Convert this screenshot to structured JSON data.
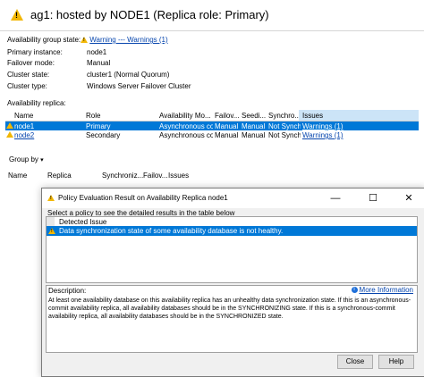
{
  "header": {
    "title": "ag1: hosted by NODE1 (Replica role: Primary)"
  },
  "properties": [
    {
      "label": "Availability group state:",
      "value": "Warning --- Warnings (1)",
      "is_link": true
    },
    {
      "label": "Primary instance:",
      "value": "node1"
    },
    {
      "label": "Failover mode:",
      "value": "Manual"
    },
    {
      "label": "Cluster state:",
      "value": "cluster1 (Normal Quorum)"
    },
    {
      "label": "Cluster type:",
      "value": "Windows Server Failover Cluster"
    }
  ],
  "replica_section": {
    "label": "Availability replica:",
    "columns": [
      "Name",
      "Role",
      "Availability Mo...",
      "Failov...",
      "Seedi...",
      "Synchro...",
      "Issues"
    ],
    "rows": [
      {
        "name": "node1",
        "role": "Primary",
        "availability_mode": "Asynchronous co...",
        "failover": "Manual",
        "seeding": "Manual",
        "sync": "Not Synchron...",
        "issues": "Warnings (1)"
      },
      {
        "name": "node2",
        "role": "Secondary",
        "availability_mode": "Asynchronous co...",
        "failover": "Manual",
        "seeding": "Manual",
        "sync": "Not Synchron...",
        "issues": "Warnings (1)"
      }
    ]
  },
  "group_by": {
    "label": "Group by",
    "arrow": "▾"
  },
  "db_columns": [
    "Name",
    "Replica",
    "Synchroniz...",
    "Failov...",
    "Issues"
  ],
  "dialog": {
    "title": "Policy Evaluation Result on Availability Replica node1",
    "minimize": "—",
    "maximize": "☐",
    "close": "✕",
    "instruction": "Select a policy to see the detailed results in the table below",
    "list_header": "Detected Issue",
    "list_item": "Data synchronization state of some availability database is not healthy.",
    "description_label": "Description:",
    "more_info": "More Information",
    "description": "At least one availability database on this availability replica has an unhealthy data synchronization state. If this is an asynchronous-commit availability replica, all availability databases should be in the SYNCHRONIZING state. If this is a synchronous-commit availability replica, all availability databases should be in the SYNCHRONIZED state.",
    "close_button": "Close",
    "help_button": "Help"
  }
}
